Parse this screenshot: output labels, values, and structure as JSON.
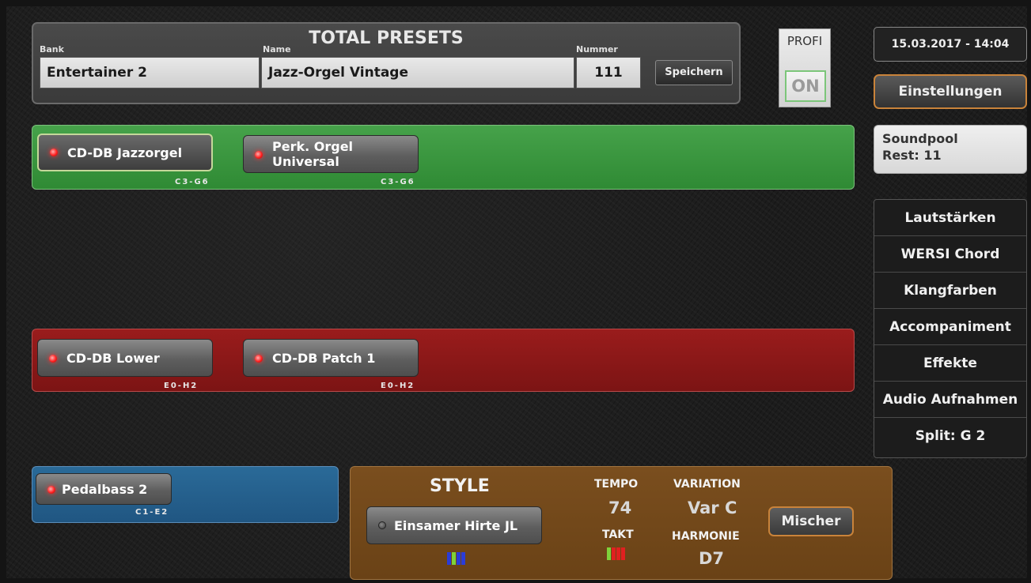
{
  "preset": {
    "title": "TOTAL PRESETS",
    "bank_label": "Bank",
    "name_label": "Name",
    "number_label": "Nummer",
    "bank_value": "Entertainer 2",
    "name_value": "Jazz-Orgel Vintage",
    "number_value": "111",
    "save_label": "Speichern"
  },
  "profi": {
    "label": "PROFI",
    "state": "ON"
  },
  "datetime": "15.03.2017 - 14:04",
  "settings_label": "Einstellungen",
  "soundpool": {
    "line1": "Soundpool",
    "line2": "Rest: 11"
  },
  "menu": [
    "Lautstärken",
    "WERSI Chord",
    "Klangfarben",
    "Accompaniment",
    "Effekte",
    "Audio Aufnahmen",
    "Split: G 2"
  ],
  "upper": {
    "color": "#3a963e",
    "voices": [
      {
        "line1": "CD-DB Jazzorgel",
        "line2": "",
        "range": "C3-G6",
        "led": "on",
        "selected": true
      },
      {
        "line1": "Perk. Orgel",
        "line2": "Universal",
        "range": "C3-G6",
        "led": "on",
        "selected": false
      }
    ]
  },
  "lower": {
    "color": "#8a1818",
    "voices": [
      {
        "line1": "CD-DB Lower",
        "range": "E0-H2",
        "led": "on"
      },
      {
        "line1": "CD-DB Patch 1",
        "range": "E0-H2",
        "led": "on"
      }
    ]
  },
  "pedal": {
    "color": "#24608c",
    "voices": [
      {
        "line1": "Pedalbass 2",
        "range": "C1-E2",
        "led": "on"
      }
    ]
  },
  "style": {
    "heading": "STYLE",
    "name": "Einsamer Hirte JL",
    "led": "off",
    "tempo_label": "TEMPO",
    "tempo_value": "74",
    "takt_label": "TAKT",
    "variation_label": "VARIATION",
    "variation_value": "Var C",
    "harmonie_label": "HARMONIE",
    "harmonie_value": "D7",
    "mixer_label": "Mischer",
    "style_indicator_colors": [
      "#2a3cd8",
      "#7ed23a",
      "#2a3cd8",
      "#2a3cd8"
    ],
    "takt_indicator_colors": [
      "#7ed23a",
      "#e02020",
      "#e02020",
      "#e02020"
    ]
  }
}
